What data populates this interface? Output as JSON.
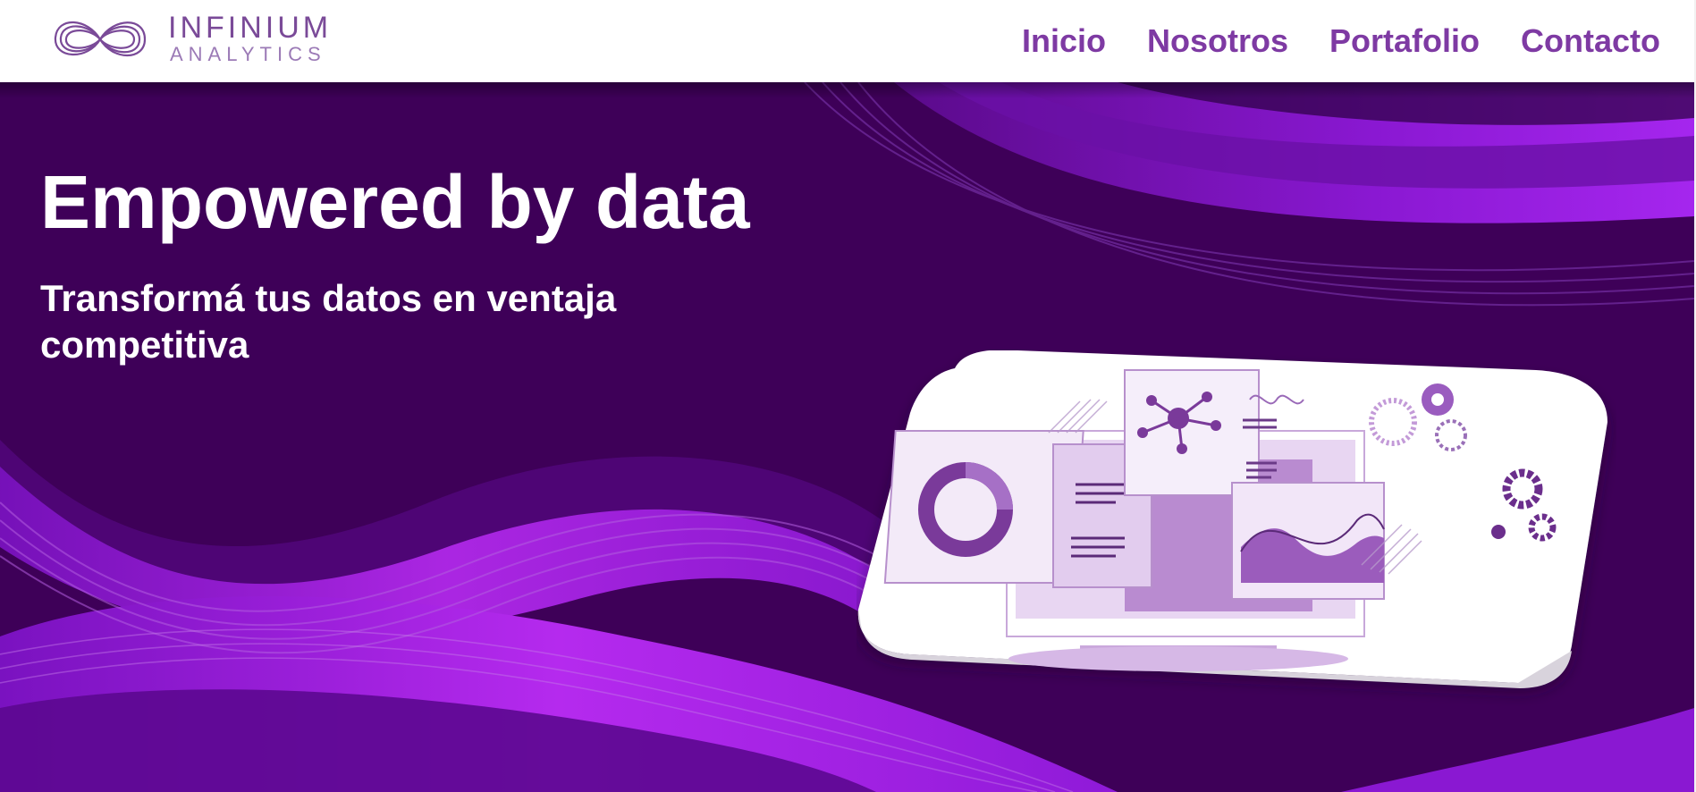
{
  "brand": {
    "name": "INFINIUM",
    "tagline": "ANALYTICS",
    "logo_icon": "infinity-ribbon-icon",
    "color": "#7a4a98"
  },
  "nav": {
    "items": [
      {
        "label": "Inicio"
      },
      {
        "label": "Nosotros"
      },
      {
        "label": "Portafolio"
      },
      {
        "label": "Contacto"
      }
    ],
    "color": "#7e3aa3"
  },
  "hero": {
    "title": "Empowered by data",
    "subtitle": "Transformá tus datos en ventaja competitiva",
    "background_color": "#3e0058",
    "accent_color": "#b21ee8",
    "illustration": {
      "icons": [
        "monitor-icon",
        "donut-chart-icon",
        "network-node-icon",
        "area-chart-icon",
        "document-lines-icon",
        "gear-icon"
      ]
    }
  }
}
